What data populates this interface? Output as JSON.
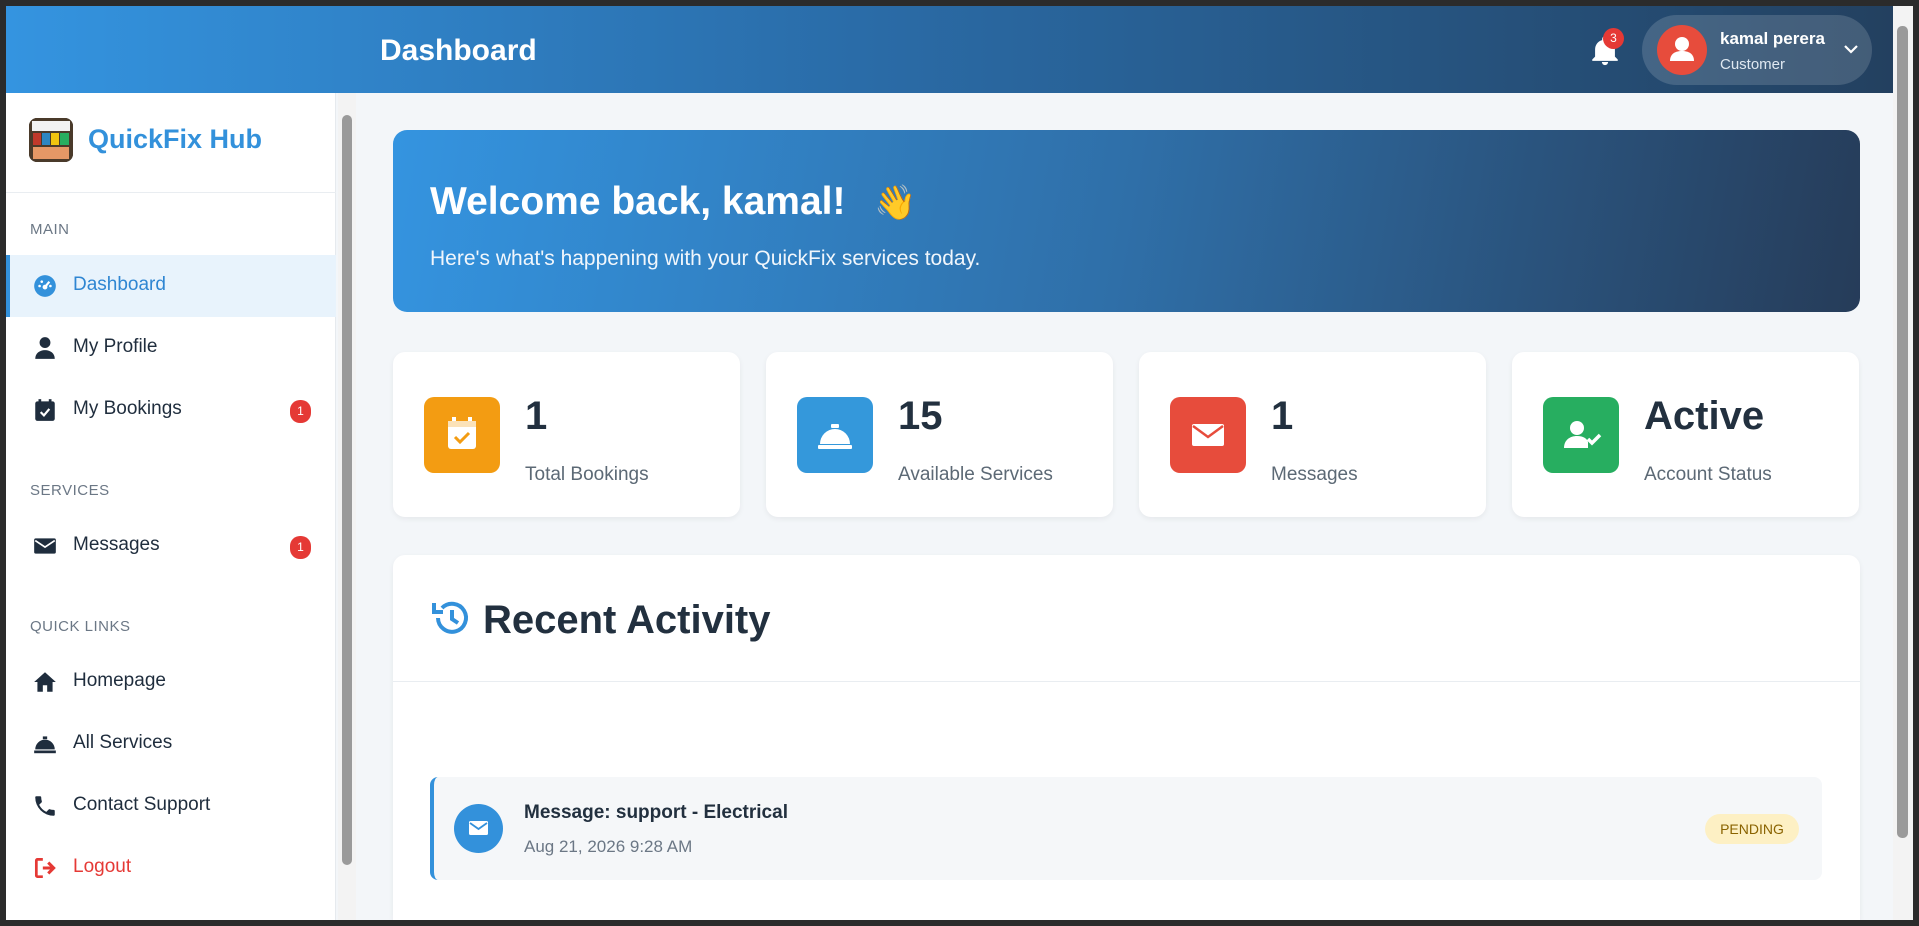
{
  "header": {
    "title": "Dashboard",
    "notifications_count": "3",
    "user": {
      "name": "kamal perera",
      "role": "Customer"
    }
  },
  "sidebar": {
    "brand": "QuickFix Hub",
    "sections": {
      "main": "MAIN",
      "services": "SERVICES",
      "quick_links": "QUICK LINKS"
    },
    "items": [
      {
        "label": "Dashboard",
        "icon": "dashboard-icon",
        "active": true
      },
      {
        "label": "My Profile",
        "icon": "user-icon"
      },
      {
        "label": "My Bookings",
        "icon": "calendar-check-icon",
        "badge": "1"
      },
      {
        "label": "Messages",
        "icon": "envelope-icon",
        "badge": "1"
      },
      {
        "label": "Homepage",
        "icon": "home-icon"
      },
      {
        "label": "All Services",
        "icon": "concierge-bell-icon"
      },
      {
        "label": "Contact Support",
        "icon": "phone-icon"
      },
      {
        "label": "Logout",
        "icon": "sign-out-icon"
      }
    ]
  },
  "welcome": {
    "title": "Welcome back, kamal!",
    "emoji": "👋",
    "subtitle": "Here's what's happening with your QuickFix services today."
  },
  "stats": [
    {
      "value": "1",
      "label": "Total Bookings",
      "icon": "calendar-check-icon",
      "color": "#f39c12"
    },
    {
      "value": "15",
      "label": "Available Services",
      "icon": "concierge-bell-icon",
      "color": "#3498db"
    },
    {
      "value": "1",
      "label": "Messages",
      "icon": "envelope-icon",
      "color": "#e74c3c"
    },
    {
      "value": "Active",
      "label": "Account Status",
      "icon": "user-check-icon",
      "color": "#27ae60"
    }
  ],
  "activity": {
    "title": "Recent Activity",
    "items": [
      {
        "title": "Message: support - Electrical",
        "date": "Aug 21, 2026 9:28 AM",
        "status": "PENDING"
      }
    ]
  },
  "colors": {
    "accent": "#3391db",
    "danger": "#e53935",
    "text": "#22303f"
  }
}
